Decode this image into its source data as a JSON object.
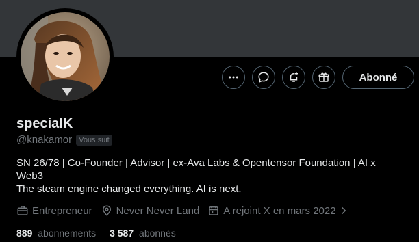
{
  "profile": {
    "name": "specialK",
    "handle": "@knakamor",
    "follows_you": "Vous suit",
    "bio_line1": "SN 26/78 | Co-Founder | Advisor | ex-Ava Labs & Opentensor Foundation | AI x Web3",
    "bio_line2": "The steam engine changed everything. AI is next."
  },
  "actions": {
    "more_icon": "more-horizontal-icon",
    "message_icon": "message-bubble-icon",
    "notify_icon": "bell-plus-icon",
    "subscribe_icon": "gift-icon",
    "follow_label": "Abonné"
  },
  "meta": {
    "profession": "Entrepreneur",
    "location": "Never Never Land",
    "joined": "A rejoint X en mars 2022"
  },
  "stats": {
    "following_count": "889",
    "following_label": "abonnements",
    "followers_count": "3 587",
    "followers_label": "abonnés"
  },
  "colors": {
    "background": "#000000",
    "banner": "#333639",
    "text": "#e7e9ea",
    "secondary": "#71767b",
    "border": "#536471"
  }
}
